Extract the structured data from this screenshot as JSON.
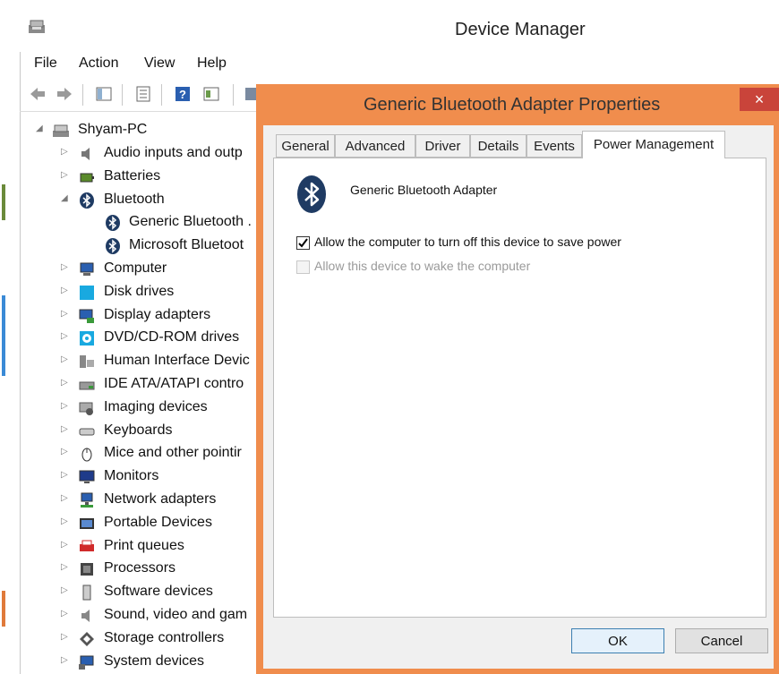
{
  "device_manager": {
    "title": "Device Manager",
    "menu": [
      "File",
      "Action",
      "View",
      "Help"
    ],
    "toolbar_icons": [
      "back-arrow-icon",
      "forward-arrow-icon",
      "show-hide-tree-icon",
      "properties-icon",
      "help-icon",
      "view-icon"
    ],
    "tree": {
      "root": "Shyam-PC",
      "items": [
        {
          "label": "Audio inputs and outp",
          "icon": "speaker-icon",
          "expanded": false
        },
        {
          "label": "Batteries",
          "icon": "battery-icon",
          "expanded": false
        },
        {
          "label": "Bluetooth",
          "icon": "bluetooth-icon",
          "expanded": true,
          "children": [
            "Generic Bluetooth .",
            "Microsoft Bluetoot"
          ]
        },
        {
          "label": "Computer",
          "icon": "computer-icon",
          "expanded": false
        },
        {
          "label": "Disk drives",
          "icon": "disk-drive-icon",
          "expanded": false
        },
        {
          "label": "Display adapters",
          "icon": "display-adapter-icon",
          "expanded": false
        },
        {
          "label": "DVD/CD-ROM drives",
          "icon": "dvd-icon",
          "expanded": false
        },
        {
          "label": "Human Interface Devic",
          "icon": "hid-icon",
          "expanded": false
        },
        {
          "label": "IDE ATA/ATAPI contro",
          "icon": "ide-icon",
          "expanded": false
        },
        {
          "label": "Imaging devices",
          "icon": "imaging-icon",
          "expanded": false
        },
        {
          "label": "Keyboards",
          "icon": "keyboard-icon",
          "expanded": false
        },
        {
          "label": "Mice and other pointir",
          "icon": "mouse-icon",
          "expanded": false
        },
        {
          "label": "Monitors",
          "icon": "monitor-icon",
          "expanded": false
        },
        {
          "label": "Network adapters",
          "icon": "network-icon",
          "expanded": false
        },
        {
          "label": "Portable Devices",
          "icon": "portable-device-icon",
          "expanded": false
        },
        {
          "label": "Print queues",
          "icon": "printer-icon",
          "expanded": false
        },
        {
          "label": "Processors",
          "icon": "processor-icon",
          "expanded": false
        },
        {
          "label": "Software devices",
          "icon": "software-device-icon",
          "expanded": false
        },
        {
          "label": "Sound, video and gam",
          "icon": "sound-icon",
          "expanded": false
        },
        {
          "label": "Storage controllers",
          "icon": "storage-icon",
          "expanded": false
        },
        {
          "label": "System devices",
          "icon": "system-device-icon",
          "expanded": false
        }
      ]
    }
  },
  "dialog": {
    "title": "Generic Bluetooth Adapter Properties",
    "close": "×",
    "tabs": [
      "General",
      "Advanced",
      "Driver",
      "Details",
      "Events",
      "Power Management"
    ],
    "active_tab": "Power Management",
    "device_name": "Generic Bluetooth Adapter",
    "options": [
      {
        "label": "Allow the computer to turn off this device to save power",
        "checked": true,
        "enabled": true
      },
      {
        "label": "Allow this device to wake the computer",
        "checked": false,
        "enabled": false
      }
    ],
    "ok_label": "OK",
    "cancel_label": "Cancel"
  },
  "colors": {
    "dialog_frame": "#f08d4d",
    "close_button": "#c9443a",
    "bluetooth": "#1f3b63"
  }
}
